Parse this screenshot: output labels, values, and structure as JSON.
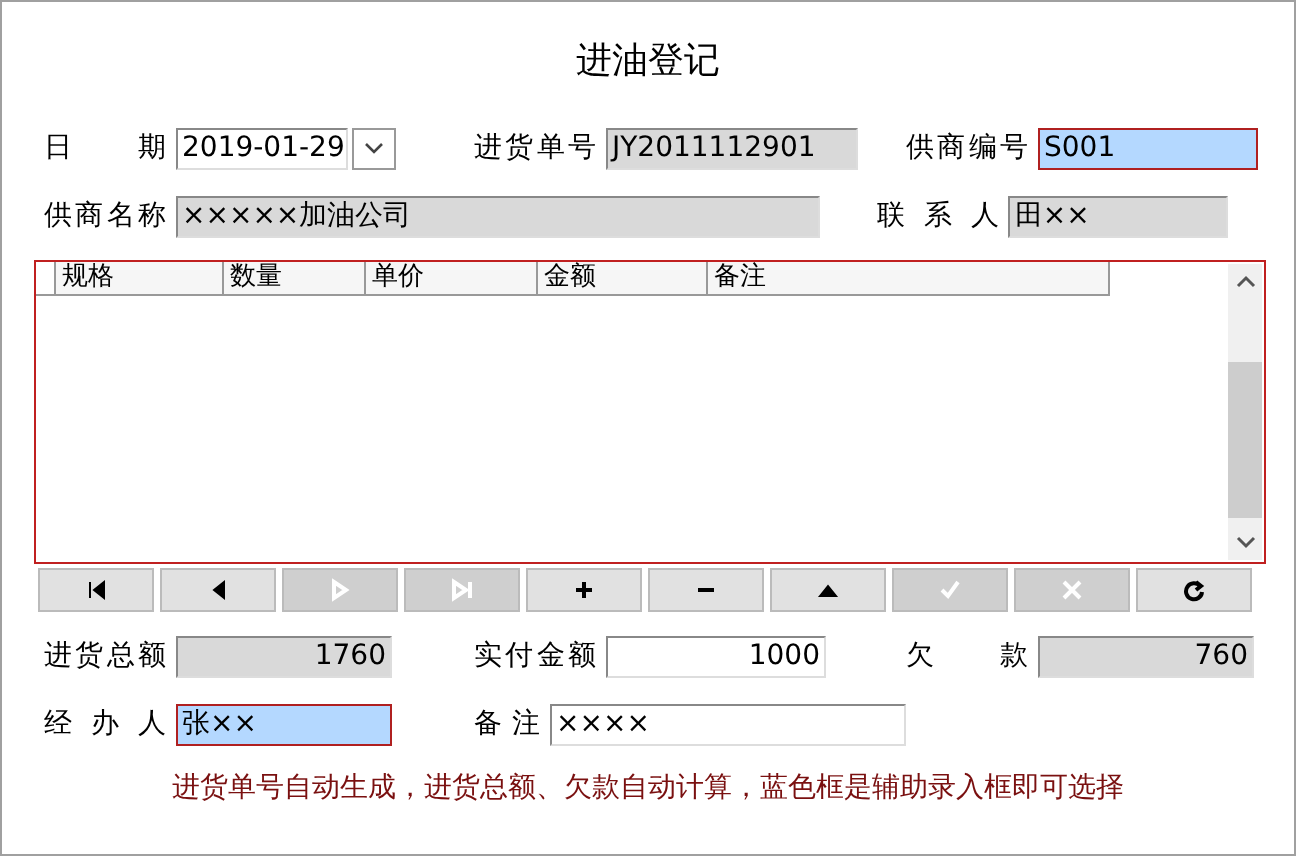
{
  "window": {
    "title": "进油登记"
  },
  "top_rows": [
    [
      {
        "label": "日 期",
        "value": "2019-01-29",
        "kind": "date"
      },
      {
        "label": "进货单号",
        "value": "JY2011112901",
        "kind": "readonly"
      },
      {
        "label": "供商编号",
        "value": "S001",
        "kind": "assist"
      }
    ],
    [
      {
        "label": "供商名称",
        "value": "×××××加油公司",
        "kind": "readonly"
      },
      {
        "label": "联 系 人",
        "value": "田××",
        "kind": "readonly"
      }
    ]
  ],
  "table": {
    "columns": [
      "规格",
      "数量",
      "单价",
      "金额",
      "备注"
    ]
  },
  "nav_buttons": [
    {
      "kind": "first",
      "disabled": false
    },
    {
      "kind": "prev",
      "disabled": false
    },
    {
      "kind": "next",
      "disabled": true
    },
    {
      "kind": "last",
      "disabled": true
    },
    {
      "kind": "add",
      "disabled": false
    },
    {
      "kind": "delete",
      "disabled": false
    },
    {
      "kind": "edit",
      "disabled": false
    },
    {
      "kind": "save",
      "disabled": true
    },
    {
      "kind": "cancel",
      "disabled": true
    },
    {
      "kind": "refresh",
      "disabled": false
    }
  ],
  "bottom_rows": [
    [
      {
        "label": "进货总额",
        "value": "1760",
        "kind": "readonly"
      },
      {
        "label": "实付金额",
        "value": "1000",
        "kind": "editable"
      },
      {
        "label": "欠 款",
        "value": "760",
        "kind": "readonly"
      }
    ],
    [
      {
        "label": "经 办 人",
        "value": "张××",
        "kind": "assist"
      },
      {
        "label": "备 注",
        "value": "××××",
        "kind": "editable"
      }
    ]
  ],
  "note": "进货单号自动生成，进货总额、欠款自动计算，蓝色框是辅助录入框即可选择"
}
